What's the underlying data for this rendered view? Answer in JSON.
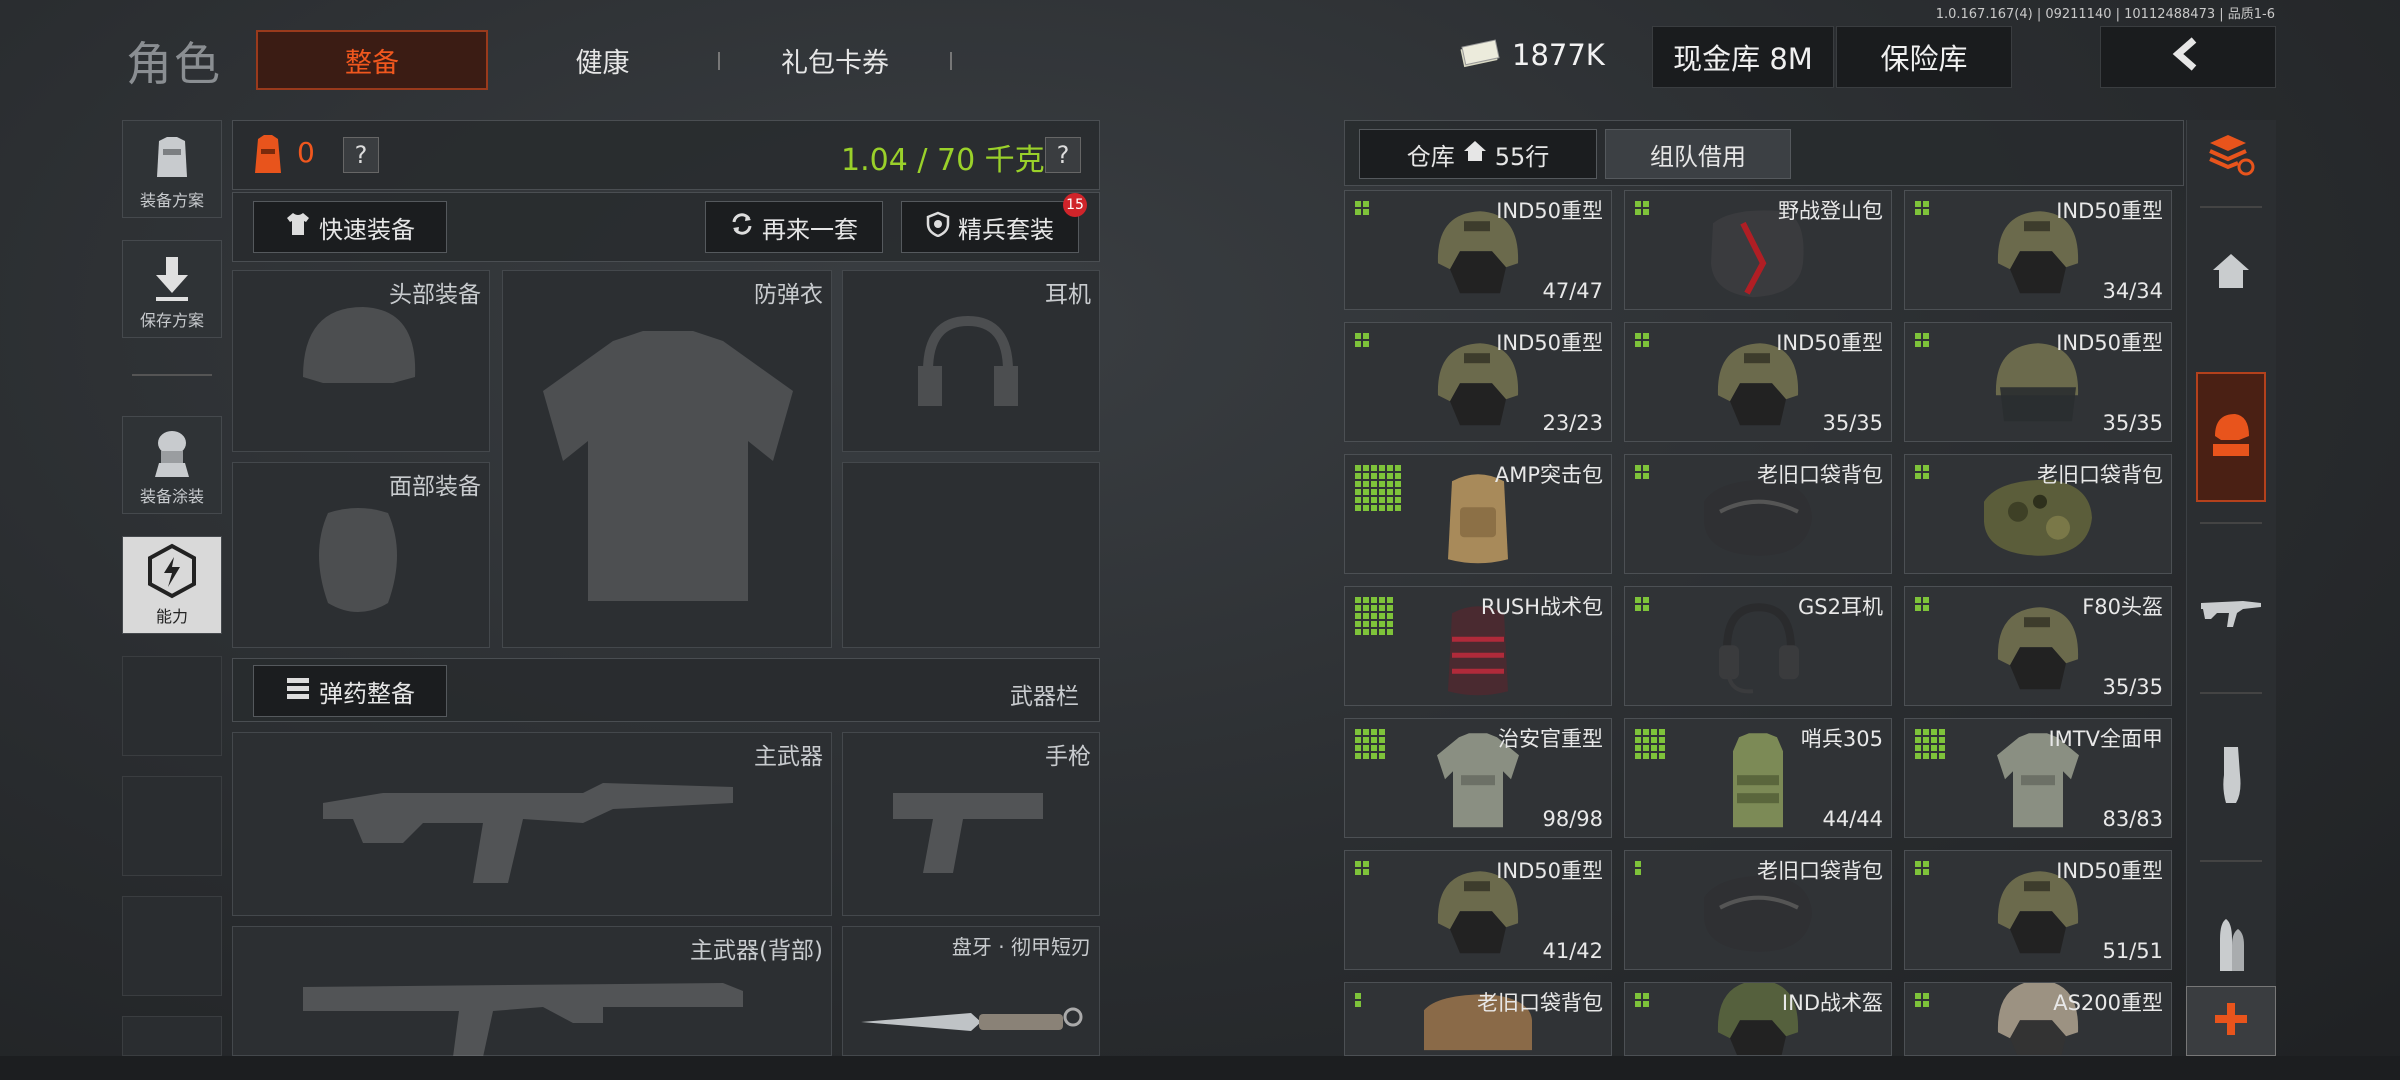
{
  "version": "1.0.167.167(4) | 09211140 | 10112488473 | 品质1-6",
  "title": "角色",
  "tabs": [
    {
      "label": "整备",
      "active": true
    },
    {
      "label": "健康",
      "active": false
    },
    {
      "label": "礼包卡券",
      "active": false
    }
  ],
  "currency": {
    "money": "1877K",
    "cash_vault": "现金库 8M",
    "safe": "保险库"
  },
  "sidebar": [
    {
      "label": "装备方案"
    },
    {
      "label": "保存方案"
    },
    {
      "label": "装备涂装"
    },
    {
      "label": "能力"
    }
  ],
  "loadout": {
    "armor_count": "0",
    "weight": "1.04 / 70 千克",
    "help": "?",
    "quick_equip": "快速装备",
    "again": "再来一套",
    "elite": "精兵套装",
    "elite_badge": "15",
    "slots": {
      "head": "头部装备",
      "vest": "防弹衣",
      "ear": "耳机",
      "face": "面部装备"
    },
    "ammo": "弹药整备",
    "weapon_bar": "武器栏",
    "weapons": {
      "primary": "主武器",
      "pistol": "手枪",
      "primary_back": "主武器(背部)",
      "knife": "盘牙 · 彻甲短刃"
    }
  },
  "warehouse": {
    "tab_storage": "仓库",
    "rows": "55行",
    "tab_team": "组队借用",
    "items": [
      {
        "name": "IND50重型",
        "dur": "47/47",
        "kind": "helmet",
        "grid": 2
      },
      {
        "name": "野战登山包",
        "dur": "",
        "kind": "bag-red",
        "grid": 2
      },
      {
        "name": "IND50重型",
        "dur": "34/34",
        "kind": "helmet",
        "grid": 2
      },
      {
        "name": "IND50重型",
        "dur": "23/23",
        "kind": "helmet",
        "grid": 2
      },
      {
        "name": "IND50重型",
        "dur": "35/35",
        "kind": "helmet",
        "grid": 2
      },
      {
        "name": "IND50重型",
        "dur": "35/35",
        "kind": "helmet-visor",
        "grid": 2
      },
      {
        "name": "AMP突击包",
        "dur": "",
        "kind": "backpack-tan",
        "grid": 6
      },
      {
        "name": "老旧口袋背包",
        "dur": "",
        "kind": "bag-dark",
        "grid": 2
      },
      {
        "name": "老旧口袋背包",
        "dur": "",
        "kind": "bag-camo",
        "grid": 2
      },
      {
        "name": "RUSH战术包",
        "dur": "",
        "kind": "backpack-red",
        "grid": 5
      },
      {
        "name": "GS2耳机",
        "dur": "",
        "kind": "headset",
        "grid": 2
      },
      {
        "name": "F80头盔",
        "dur": "35/35",
        "kind": "helmet",
        "grid": 2
      },
      {
        "name": "治安官重型",
        "dur": "98/98",
        "kind": "vest",
        "grid": 4
      },
      {
        "name": "哨兵305",
        "dur": "44/44",
        "kind": "vest-green",
        "grid": 4
      },
      {
        "name": "IMTV全面甲",
        "dur": "83/83",
        "kind": "vest",
        "grid": 4
      },
      {
        "name": "IND50重型",
        "dur": "41/42",
        "kind": "helmet",
        "grid": 2
      },
      {
        "name": "老旧口袋背包",
        "dur": "",
        "kind": "bag-dark",
        "grid": 1
      },
      {
        "name": "IND50重型",
        "dur": "51/51",
        "kind": "helmet",
        "grid": 2
      },
      {
        "name": "老旧口袋背包",
        "dur": "",
        "kind": "bag-brown",
        "grid": 1
      },
      {
        "name": "IND战术盔",
        "dur": "",
        "kind": "helmet-green",
        "grid": 2
      },
      {
        "name": "AS200重型",
        "dur": "",
        "kind": "helmet-tan",
        "grid": 2
      }
    ]
  },
  "colors": {
    "accent": "#f0571e",
    "green": "#7ec33a",
    "weight_green": "#9ad12a"
  }
}
